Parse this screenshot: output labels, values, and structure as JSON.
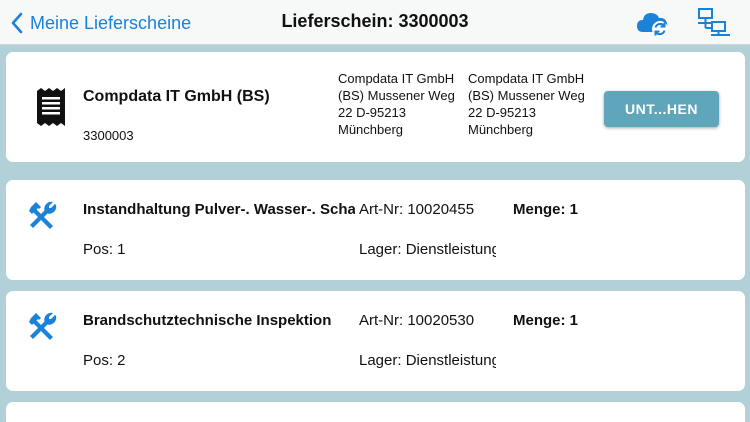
{
  "navbar": {
    "back_label": "Meine Lieferscheine",
    "title": "Lieferschein: 3300003",
    "icons": [
      "chevron-left-icon",
      "cloud-sync-icon",
      "network-icon"
    ],
    "accent_color": "#1a82d8"
  },
  "header": {
    "icon": "receipt-icon",
    "company": "Compdata IT GmbH (BS)",
    "number": "3300003",
    "address1": "Compdata IT GmbH (BS) Mussener Weg 22 D-95213 Münchberg",
    "address2": "Compdata IT GmbH (BS) Mussener Weg 22 D-95213 Münchberg",
    "sign_button": "UNT...HEN",
    "button_color": "#5fa6ba"
  },
  "items": [
    {
      "icon": "hammer-wrench-icon",
      "title": "Instandhaltung Pulver-. Wasser-. Schaumlöscher",
      "artnr": "Art-Nr: 10020455",
      "menge": "Menge: 1",
      "pos": "Pos: 1",
      "lager": "Lager: Dienstleistung"
    },
    {
      "icon": "hammer-wrench-icon",
      "title": "Brandschutztechnische Inspektion",
      "artnr": "Art-Nr: 10020530",
      "menge": "Menge: 1",
      "pos": "Pos: 2",
      "lager": "Lager: Dienstleistung"
    }
  ],
  "colors": {
    "background": "#b2d0d8",
    "card": "#ffffff",
    "icon_blue": "#1a82d8"
  }
}
